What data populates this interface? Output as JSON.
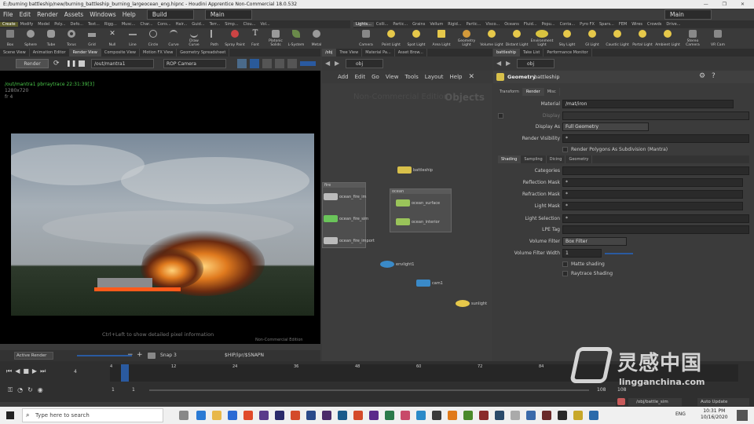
{
  "title": "E:/burning battleship/new/burning_battleship_burning_largeocean_eng.hipnc - Houdini Apprentice Non-Commercial 18.0.532",
  "menu": [
    "File",
    "Edit",
    "Render",
    "Assets",
    "Windows",
    "Help"
  ],
  "desktops": {
    "left": "Build",
    "right": "Main",
    "far_right": "Main"
  },
  "shelf_tabs_left": [
    "Create",
    "Modify",
    "Model",
    "Poly...",
    "Defo...",
    "Text...",
    "Rigg...",
    "Musc...",
    "Char...",
    "Cons...",
    "Hair...",
    "Guid...",
    "Terr...",
    "Simp...",
    "Clou...",
    "Vol..."
  ],
  "shelf_tabs_right": [
    "Lights...",
    "Colli...",
    "Partic...",
    "Grains",
    "Vellum",
    "Rigid...",
    "Partic...",
    "Visco...",
    "Oceans",
    "Fluid...",
    "Popu...",
    "Conta...",
    "Pyro FX",
    "Spars...",
    "FEM",
    "Wires",
    "Crowds",
    "Drive..."
  ],
  "tools_left": [
    "Box",
    "Sphere",
    "Tube",
    "Torus",
    "Grid",
    "Null",
    "Line",
    "Circle",
    "Curve",
    "Draw Curve",
    "Path",
    "Spray Paint",
    "Font",
    "Platonic Solids",
    "L-System",
    "Metal"
  ],
  "tools_right": [
    "Camera",
    "Point Light",
    "Spot Light",
    "Area Light",
    "Geometry Light",
    "Volume Light",
    "Distant Light",
    "Environment Light",
    "Sky Light",
    "GI Light",
    "Caustic Light",
    "Portal Light",
    "Ambient Light",
    "Stereo Camera",
    "VR Cam"
  ],
  "left_tabs": [
    "Scene View",
    "Animation Editor",
    "Render View",
    "Composite View",
    "Motion FX View",
    "Geometry Spreadsheet"
  ],
  "render_bar": {
    "button": "Render",
    "rop": "/out/mantra1",
    "camera": "ROP Camera"
  },
  "render_info": [
    "/out/mantra1 pbrraytrace  22:31:39[3]",
    "1280x720",
    "fr 4"
  ],
  "viewport_hint": "Ctrl+Left to show detailed pixel information",
  "watermark_nc": "Non-Commercial Edition",
  "viewport_bottom": {
    "active": "Active Render",
    "snap": "Snap 3",
    "path": "$HIP/ipr/$SNAPN"
  },
  "mid_path": "obj",
  "mid_tabs": [
    "/obj",
    "Tree View",
    "Material Pa...",
    "Asset Brow..."
  ],
  "net_menu": [
    "Add",
    "Edit",
    "Go",
    "View",
    "Tools",
    "Layout",
    "Help"
  ],
  "net_label": "Objects",
  "net_watermark": "Non-Commercial Edition",
  "nodes": {
    "battleship": "battleship",
    "fire_group": "fire",
    "ocean_group": "ocean",
    "fire1": "ocean_fire_im",
    "fire2": "ocean_fire_sim",
    "fire3": "ocean_fire_import",
    "surf": "ocean_surface",
    "interior": "ocean_interior",
    "env": "envlight1",
    "cam": "cam1",
    "sun": "sunlight"
  },
  "right_tabs": [
    "battleship",
    "Take List",
    "Performance Monitor"
  ],
  "right_path": "obj",
  "geo": {
    "type": "Geometry",
    "name": "battleship"
  },
  "prop_tabs": [
    "Transform",
    "Render",
    "Misc"
  ],
  "props": [
    {
      "label": "Material",
      "value": "/mat/iron"
    },
    {
      "label": "Display",
      "value": ""
    },
    {
      "label": "Display As",
      "value": "Full Geometry"
    },
    {
      "label": "Render Visibility",
      "value": "*"
    }
  ],
  "check_subdiv": "Render Polygons As Subdivision (Mantra)",
  "sub_tabs": [
    "Shading",
    "Sampling",
    "Dicing",
    "Geometry"
  ],
  "shading": [
    {
      "label": "Categories",
      "value": ""
    },
    {
      "label": "Reflection Mask",
      "value": "*"
    },
    {
      "label": "Refraction Mask",
      "value": "*"
    },
    {
      "label": "Light Mask",
      "value": "*"
    },
    {
      "label": "Light Selection",
      "value": "*"
    },
    {
      "label": "LPE Tag",
      "value": ""
    },
    {
      "label": "Volume Filter",
      "value": "Box Filter"
    },
    {
      "label": "Volume Filter Width",
      "value": "1"
    }
  ],
  "checks": [
    "Matte shading",
    "Raytrace Shading"
  ],
  "timeline": {
    "frame": "4",
    "ticks": [
      "4",
      "12",
      "24",
      "36",
      "48",
      "60",
      "72",
      "84"
    ],
    "start": "1",
    "start2": "1",
    "end": "108",
    "end2": "108"
  },
  "statusbar": {
    "path": "/obj/battle_sim",
    "update": "Auto Update"
  },
  "taskbar": {
    "search": "Type here to search",
    "lang": "ENG",
    "time": "10:31 PM",
    "date": "10/16/2020"
  },
  "site_watermark": {
    "cn": "灵感中国",
    "url": "lingganchina.com"
  }
}
